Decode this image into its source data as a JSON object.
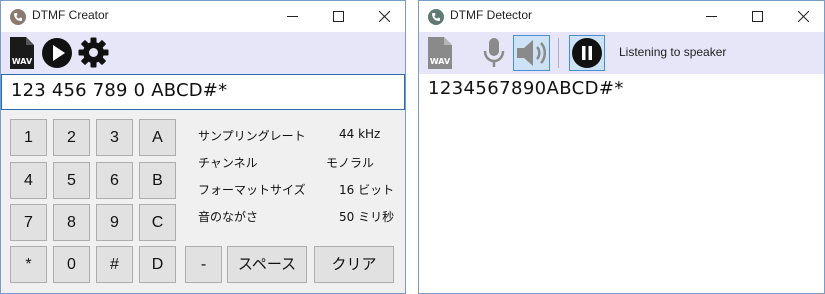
{
  "creator": {
    "title": "DTMF Creator",
    "toolbar": {
      "wav_icon": "wav-file-icon",
      "wav_text": "WAV",
      "play_icon": "play-icon",
      "settings_icon": "gear-icon"
    },
    "digits_value": "123 456 789 0 ABCD#*",
    "keypad": {
      "rows": [
        [
          "1",
          "2",
          "3",
          "A"
        ],
        [
          "4",
          "5",
          "6",
          "B"
        ],
        [
          "7",
          "8",
          "9",
          "C"
        ],
        [
          "*",
          "0",
          "#",
          "D"
        ]
      ],
      "dash": "-",
      "space": "スペース",
      "clear": "クリア"
    },
    "info": [
      {
        "label": "サンプリングレート",
        "value": "44 kHz"
      },
      {
        "label": "チャンネル",
        "value": "モノラル"
      },
      {
        "label": "フォーマットサイズ",
        "value": "16 ビット"
      },
      {
        "label": "音のながさ",
        "value": "50 ミリ秒"
      }
    ]
  },
  "detector": {
    "title": "DTMF Detector",
    "toolbar": {
      "wav_icon": "wav-file-icon",
      "wav_text": "WAV",
      "mic_icon": "microphone-icon",
      "speaker_icon": "speaker-icon",
      "pause_icon": "pause-icon"
    },
    "status": "Listening to speaker",
    "detected_value": "1234567890ABCD#*"
  },
  "colors": {
    "toolbar_bg": "#e6e6f8",
    "accent": "#2b6cb0",
    "button_bg": "#e1e1e1"
  }
}
